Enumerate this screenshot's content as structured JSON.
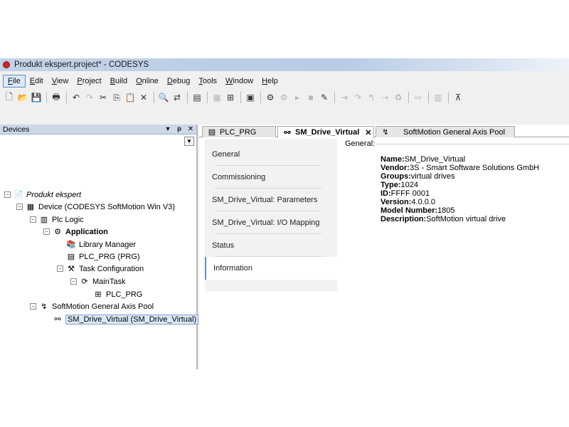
{
  "window": {
    "title": "Produkt ekspert.project* - CODESYS"
  },
  "menu": [
    {
      "ul": "F",
      "rest": "ile"
    },
    {
      "ul": "E",
      "rest": "dit"
    },
    {
      "ul": "V",
      "rest": "iew"
    },
    {
      "ul": "P",
      "rest": "roject"
    },
    {
      "ul": "B",
      "rest": "uild"
    },
    {
      "ul": "O",
      "rest": "nline"
    },
    {
      "ul": "D",
      "rest": "ebug"
    },
    {
      "ul": "T",
      "rest": "ools"
    },
    {
      "ul": "W",
      "rest": "indow"
    },
    {
      "ul": "H",
      "rest": "elp"
    }
  ],
  "toolbar_icons": [
    "new-icon",
    "open-icon",
    "save-icon",
    "sep",
    "print-icon",
    "sep",
    "undo-icon",
    "redo-icon",
    "cut-icon",
    "copy-icon",
    "paste-icon",
    "delete-icon",
    "sep",
    "find-icon",
    "replace-icon",
    "sep",
    "properties-icon",
    "sep",
    "cols-icon",
    "add-icon",
    "sep",
    "browse-icon",
    "sep",
    "login-icon",
    "logout-icon",
    "run-icon",
    "stop-icon",
    "breakpoint-icon",
    "sep",
    "step-icon",
    "step-over-icon",
    "step-out-icon",
    "step-cursor-icon",
    "recycle-icon",
    "sep",
    "arrow-icon",
    "sep",
    "monitor-icon",
    "sep",
    "cart-icon"
  ],
  "devices": {
    "title": "Devices",
    "controls": {
      "dropdown": "▾",
      "pin": "ᵽ",
      "close": "✕"
    },
    "tree": [
      {
        "label": "Produkt ekspert",
        "icon": "project-icon",
        "expander": "−"
      },
      {
        "label": "Device (CODESYS SoftMotion Win V3)",
        "icon": "device-icon",
        "expander": "−"
      },
      {
        "label": "Plc Logic",
        "icon": "plc-logic-icon",
        "expander": "−"
      },
      {
        "label": "Application",
        "icon": "application-icon",
        "expander": "−"
      },
      {
        "label": "Library Manager",
        "icon": "library-icon"
      },
      {
        "label": "PLC_PRG (PRG)",
        "icon": "program-icon"
      },
      {
        "label": "Task Configuration",
        "icon": "task-config-icon",
        "expander": "−"
      },
      {
        "label": "MainTask",
        "icon": "task-icon",
        "expander": "−"
      },
      {
        "label": "PLC_PRG",
        "icon": "call-icon"
      },
      {
        "label": "SoftMotion General Axis Pool",
        "icon": "axis-pool-icon",
        "expander": "−"
      },
      {
        "label": "SM_Drive_Virtual (SM_Drive_Virtual)",
        "icon": "drive-icon"
      }
    ]
  },
  "tabs": [
    {
      "label": "PLC_PRG"
    },
    {
      "label": "SM_Drive_Virtual",
      "close": "✕"
    },
    {
      "label": "SoftMotion General Axis Pool"
    }
  ],
  "nav": [
    {
      "label": "General"
    },
    {
      "label": "Commissioning"
    },
    {
      "label": "SM_Drive_Virtual: Parameters"
    },
    {
      "label": "SM_Drive_Virtual: I/O Mapping"
    },
    {
      "label": "Status"
    },
    {
      "label": "Information"
    }
  ],
  "info": {
    "section": "General:",
    "rows": [
      {
        "key": "Name:",
        "value": "SM_Drive_Virtual"
      },
      {
        "key": "Vendor:",
        "value": "3S - Smart Software Solutions GmbH"
      },
      {
        "key": "Groups:",
        "value": "virtual drives"
      },
      {
        "key": "Type:",
        "value": "1024"
      },
      {
        "key": "ID:",
        "value": "FFFF 0001"
      },
      {
        "key": "Version:",
        "value": "4.0.0.0"
      },
      {
        "key": "Model Number:",
        "value": "1805"
      },
      {
        "key": "Description:",
        "value": "SoftMotion virtual drive"
      }
    ]
  }
}
